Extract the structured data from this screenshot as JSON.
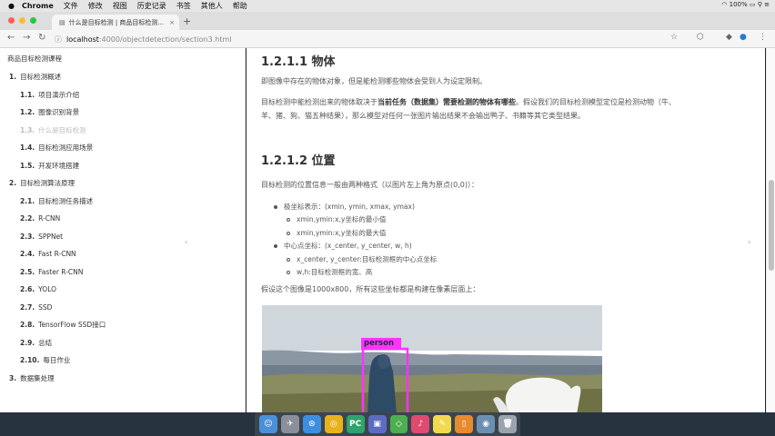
{
  "menubar": {
    "app": "Chrome",
    "items": [
      "文件",
      "修改",
      "视图",
      "历史记录",
      "书签",
      "其他人",
      "帮助"
    ],
    "status": "100%"
  },
  "browser": {
    "tab_title": "什么是目标检测 | 商品目标检测...",
    "url_host": "localhost",
    "url_path": ":4000/objectdetection/section3.html"
  },
  "sidebar": {
    "book_title": "商品目标检测课程",
    "items": [
      {
        "num": "1.",
        "label": "目标检测概述",
        "level": "ch"
      },
      {
        "num": "1.1.",
        "label": "项目演示介绍",
        "level": "sub"
      },
      {
        "num": "1.2.",
        "label": "图像识别背景",
        "level": "sub"
      },
      {
        "num": "1.3.",
        "label": "什么是目标检测",
        "level": "sub",
        "active": true
      },
      {
        "num": "1.4.",
        "label": "目标检测应用场景",
        "level": "sub"
      },
      {
        "num": "1.5.",
        "label": "开发环境搭建",
        "level": "sub"
      },
      {
        "num": "2.",
        "label": "目标检测算法原理",
        "level": "ch"
      },
      {
        "num": "2.1.",
        "label": "目标检测任务描述",
        "level": "sub"
      },
      {
        "num": "2.2.",
        "label": "R-CNN",
        "level": "sub"
      },
      {
        "num": "2.3.",
        "label": "SPPNet",
        "level": "sub"
      },
      {
        "num": "2.4.",
        "label": "Fast R-CNN",
        "level": "sub"
      },
      {
        "num": "2.5.",
        "label": "Faster R-CNN",
        "level": "sub"
      },
      {
        "num": "2.6.",
        "label": "YOLO",
        "level": "sub"
      },
      {
        "num": "2.7.",
        "label": "SSD",
        "level": "sub"
      },
      {
        "num": "2.8.",
        "label": "TensorFlow SSD接口",
        "level": "sub"
      },
      {
        "num": "2.9.",
        "label": "总结",
        "level": "sub"
      },
      {
        "num": "2.10.",
        "label": "每日作业",
        "level": "sub"
      },
      {
        "num": "3.",
        "label": "数据集处理",
        "level": "ch"
      }
    ]
  },
  "content": {
    "h_object": "1.2.1.1 物体",
    "p1": "即图像中存在的物体对象，但是能检测哪些物体会受到人为设定限制。",
    "p2_a": "目标检测中能检测出来的物体取决于",
    "p2_b": "当前任务（数据集）需要检测的物体有哪些",
    "p2_c": "。假设我们的目标检测模型定位是检测动物（牛、羊、猪、狗、猫五种结果），那么模型对任何一张图片输出结果不会输出鸭子、书籍等其它类型结果。",
    "h_position": "1.2.1.2 位置",
    "p3": "目标检测的位置信息一般由两种格式（以图片左上角为原点(0,0)）：",
    "b1": "极坐标表示：(xmin, ymin, xmax, ymax)",
    "b1a": "xmin,ymin:x,y坐标的最小值",
    "b1b": "xmin,ymin:x,y坐标的最大值",
    "b2": "中心点坐标：(x_center, y_center, w, h)",
    "b2a": "x_center, y_center:目标检测框的中心点坐标",
    "b2b": "w,h:目标检测框的宽、高",
    "p4": "假设这个图像是1000x800，所有这些坐标都是构建在像素层面上：",
    "detection_label": "person"
  },
  "dock": {
    "apps": [
      "finder-app",
      "launchpad-app",
      "safari-app",
      "chrome-app",
      "pycharm-app",
      "keynote-app",
      "maps-app",
      "music-app",
      "notes-app",
      "ibooks-app",
      "preview-app",
      "trash-app"
    ]
  },
  "colors": {
    "detection_box": "#ff33ff",
    "sky": "#cfd6dc",
    "water": "#6f7d8a",
    "grass": "#8a8d5f"
  }
}
